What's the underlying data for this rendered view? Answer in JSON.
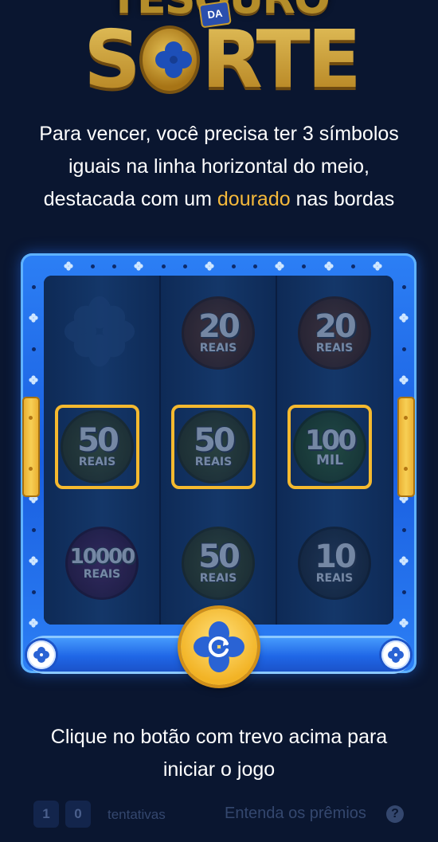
{
  "logo": {
    "top_text": "TESOURO",
    "small_text": "DA",
    "main_left": "S",
    "main_right": "RTE"
  },
  "instructions": {
    "line1": "Para vencer, você precisa ter 3 símbolos",
    "line2": "iguais na linha horizontal do meio,",
    "line3_before": "destacada com um ",
    "line3_highlight": "dourado",
    "line3_after": " nas bordas"
  },
  "reels": {
    "row1": [
      {
        "type": "clover",
        "num": "",
        "unit": ""
      },
      {
        "type": "20",
        "num": "20",
        "unit": "REAIS"
      },
      {
        "type": "20",
        "num": "20",
        "unit": "REAIS"
      }
    ],
    "row2": [
      {
        "type": "50",
        "num": "50",
        "unit": "REAIS"
      },
      {
        "type": "50",
        "num": "50",
        "unit": "REAIS"
      },
      {
        "type": "100",
        "num": "100",
        "unit": "MIL"
      }
    ],
    "row3": [
      {
        "type": "10000",
        "num": "10000",
        "unit": "REAIS"
      },
      {
        "type": "50",
        "num": "50",
        "unit": "REAIS"
      },
      {
        "type": "10",
        "num": "10",
        "unit": "REAIS"
      }
    ]
  },
  "cta": {
    "line1": "Clique no botão com trevo acima para",
    "line2": "iniciar o jogo"
  },
  "footer": {
    "attempt_digits": [
      "1",
      "0"
    ],
    "attempts_label": "tentativas",
    "prizes_link": "Entenda os prêmios",
    "help": "?"
  },
  "colors": {
    "gold": "#f5b93b",
    "frame_blue": "#2c7ff5",
    "background": "#0a1630"
  },
  "icons": {
    "spin": "clover-refresh-icon",
    "corners": "clover-icon"
  }
}
